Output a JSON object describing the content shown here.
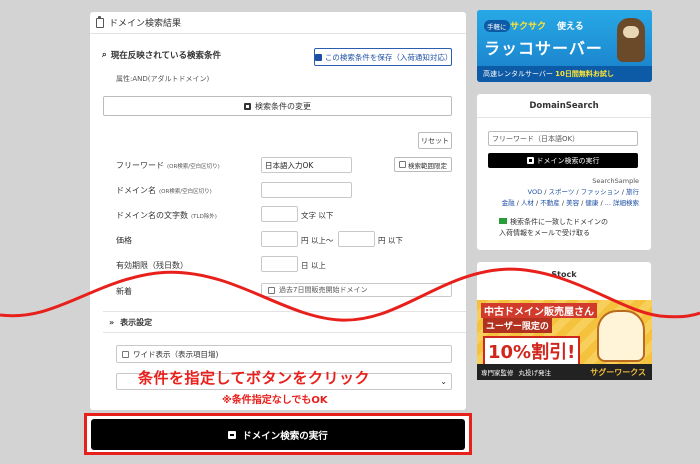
{
  "panel": {
    "title": "ドメイン検索結果",
    "search_condition_label": "現在反映されている検索条件",
    "save_button": "この検索条件を保存（入荷通知対応）",
    "attribute_text": "属性:AND(アダルトドメイン)",
    "change_button": "検索条件の変更",
    "reset_button": "リセット"
  },
  "form": {
    "free_word": {
      "label": "フリーワード",
      "note": "(OR検索/空白区切り)",
      "value": "日本語入力OK",
      "range_button": "検索範囲限定"
    },
    "domain_name": {
      "label": "ドメイン名",
      "note": "(OR検索/空白区切り)",
      "value": ""
    },
    "char_count": {
      "label": "ドメイン名の文字数",
      "note": "(TLD除外)",
      "unit": "文字 以下"
    },
    "price": {
      "label": "価格",
      "unit_from": "円 以上〜",
      "unit_to": "円 以下"
    },
    "expiry": {
      "label": "有効期限（残日数）",
      "unit": "日 以上"
    },
    "new": {
      "label": "新着",
      "checkbox_text": "過去7日間販売開始ドメイン"
    }
  },
  "display_settings": {
    "title": "表示設定",
    "wide_label": "ワイド表示（表示項目増)"
  },
  "overlay": {
    "line1": "条件を指定してボタンをクリック",
    "line2": "※条件指定なしでもOK"
  },
  "execute_button": "ドメイン検索の実行",
  "banner1": {
    "tag": "手軽に",
    "fast": "サクサク",
    "fast_suffix": "使える",
    "title": "ラッコサーバー",
    "bottom_white": "高速レンタルサーバー",
    "bottom_yellow": "10日間無料お試し"
  },
  "sidebar": {
    "title": "DomainSearch",
    "input_placeholder": "フリーワード（日本語OK）",
    "button": "ドメイン検索の実行",
    "sample_title": "SearchSample",
    "links": [
      "VOD",
      "スポーツ",
      "ファッション",
      "旅行",
      "金融",
      "人材",
      "不動産",
      "美容",
      "健康",
      "... 詳細検索"
    ],
    "mail_line1": "検索条件に一致したドメインの",
    "mail_line2": "入荷情報をメールで受け取る"
  },
  "stock": {
    "title": "Stock"
  },
  "ad2": {
    "line1": "中古ドメイン販売屋さん",
    "line2": "ユーザー限定の",
    "line3": "10%割引!",
    "badge1": "専門家監修",
    "badge2": "丸投げ発注",
    "logo": "サグーワークス"
  },
  "colors": {
    "accent_red": "#e8201c",
    "link_blue": "#1e4fa3",
    "button_black": "#000000"
  }
}
